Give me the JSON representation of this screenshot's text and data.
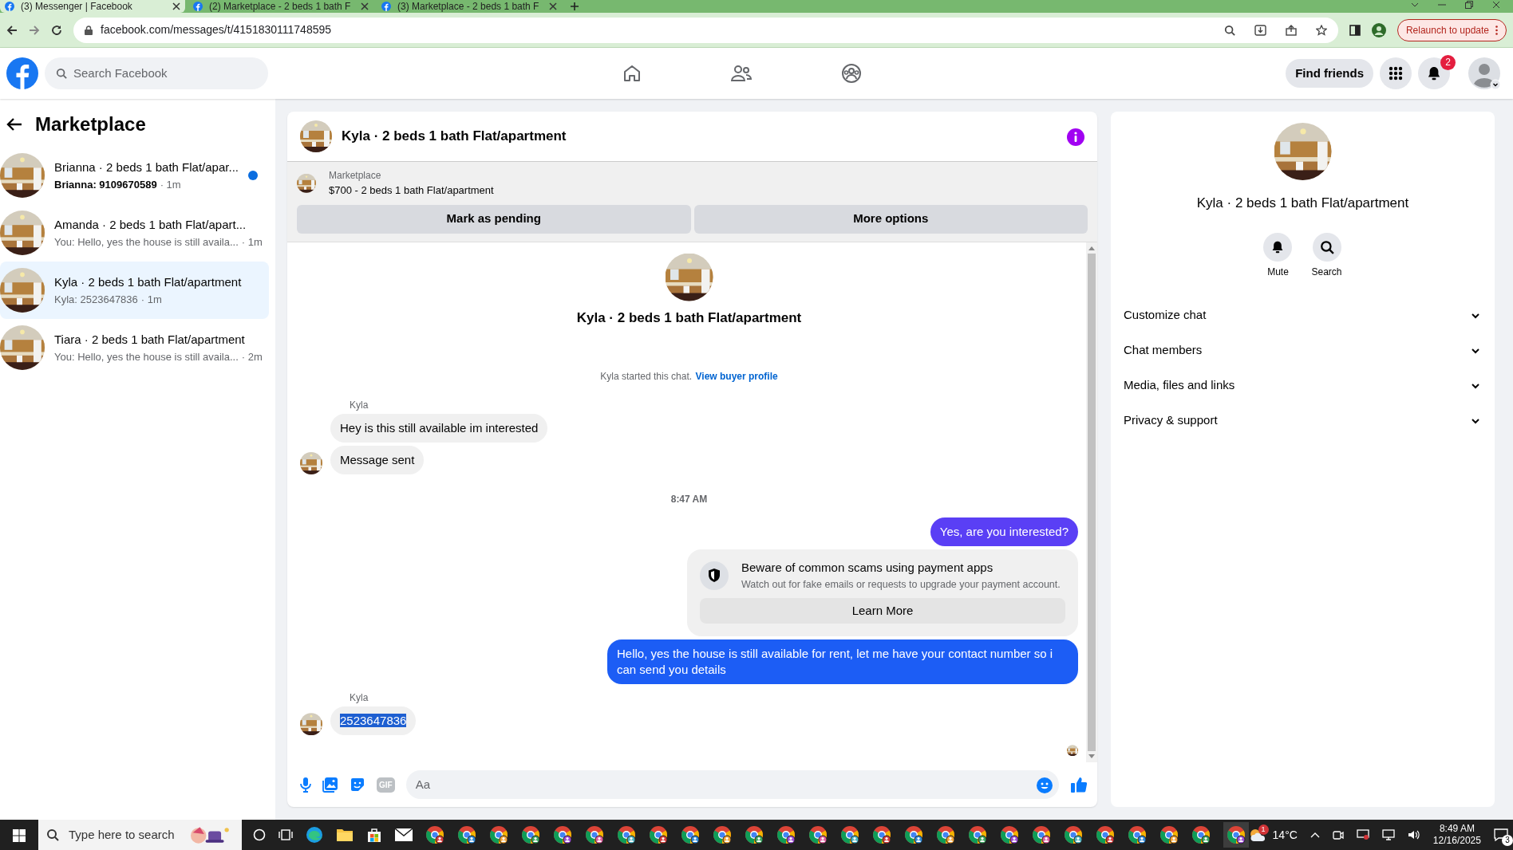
{
  "browser": {
    "tabs": [
      {
        "title": "(3) Messenger | Facebook",
        "selected": true
      },
      {
        "title": "(2) Marketplace - 2 beds 1 bath F",
        "selected": false
      },
      {
        "title": "(3) Marketplace - 2 beds 1 bath F",
        "selected": false
      }
    ],
    "url": "facebook.com/messages/t/4151830111748595",
    "relaunch": "Relaunch to update"
  },
  "header": {
    "search_placeholder": "Search Facebook",
    "find_friends": "Find friends",
    "notification_count": "2"
  },
  "sidebar": {
    "title": "Marketplace",
    "conversations": [
      {
        "name": "Brianna · 2 beds 1 bath Flat/apar...",
        "preview": "Brianna: 9109670589",
        "time": "· 1m",
        "unread": true,
        "selected": false
      },
      {
        "name": "Amanda · 2 beds 1 bath Flat/apart...",
        "preview": "You: Hello, yes the house is still availa...",
        "time": "· 1m",
        "unread": false,
        "selected": false
      },
      {
        "name": "Kyla · 2 beds 1 bath Flat/apartment",
        "preview": "Kyla: 2523647836",
        "time": "· 1m",
        "unread": false,
        "selected": true
      },
      {
        "name": "Tiara · 2 beds 1 bath Flat/apartment",
        "preview": "You: Hello, yes the house is still availa...",
        "time": "· 2m",
        "unread": false,
        "selected": false
      }
    ]
  },
  "chat": {
    "title": "Kyla · 2 beds 1 bath Flat/apartment",
    "listing": {
      "label": "Marketplace",
      "text": "$700 - 2 beds 1 bath Flat/apartment"
    },
    "actions": [
      "Mark as pending",
      "More options"
    ],
    "intro_title": "Kyla · 2 beds 1 bath Flat/apartment",
    "messages": [
      {
        "kind": "system",
        "text": "Kyla started this chat.",
        "link": "View buyer profile"
      },
      {
        "kind": "sender",
        "text": "Kyla"
      },
      {
        "kind": "incoming",
        "text": "Hey is this still available im interested",
        "avatar": false,
        "highlighted": false
      },
      {
        "kind": "incoming",
        "text": "Message sent",
        "avatar": true,
        "highlighted": false
      },
      {
        "kind": "time",
        "text": "8:47 AM"
      },
      {
        "kind": "outgoing",
        "text": "Yes, are you interested?",
        "color": "#5a3ff5"
      },
      {
        "kind": "notice",
        "title": "Beware of common scams using payment apps",
        "text": "Watch out for fake emails or requests to upgrade your payment account.",
        "button": "Learn More"
      },
      {
        "kind": "outgoing",
        "text": "Hello, yes the house is still available for rent, let me have your contact number so i can send you details",
        "color": "#1c5df5"
      },
      {
        "kind": "sender",
        "text": "Kyla"
      },
      {
        "kind": "incoming",
        "text": "2523647836",
        "avatar": true,
        "highlighted": true
      },
      {
        "kind": "receipt"
      }
    ],
    "composer": {
      "placeholder": "Aa",
      "gif": "GIF"
    }
  },
  "details": {
    "title": "Kyla · 2 beds 1 bath Flat/apartment",
    "actions": [
      {
        "kind": "mute",
        "label": "Mute"
      },
      {
        "kind": "search",
        "label": "Search"
      }
    ],
    "sections": [
      {
        "label": "Customize chat",
        "expanded": false
      },
      {
        "label": "Chat members",
        "expanded": false
      },
      {
        "label": "Media, files and links",
        "expanded": false
      },
      {
        "label": "Privacy & support",
        "expanded": false
      }
    ]
  },
  "taskbar": {
    "search_placeholder": "Type here to search",
    "weather_alert": "1",
    "temperature": "14°C",
    "time": "8:49 AM",
    "date": "12/16/2025",
    "notifications": "3"
  }
}
